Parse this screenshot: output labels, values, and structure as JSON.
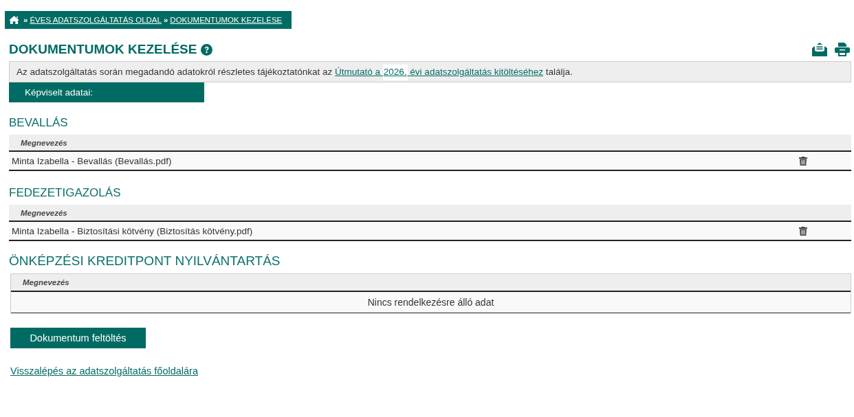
{
  "breadcrumb": [
    {
      "separator": "»",
      "label": "ÉVES ADATSZOLGÁLTATÁS OLDAL"
    },
    {
      "separator": "»",
      "label": "DOKUMENTUMOK KEZELÉSE"
    }
  ],
  "page_title": "DOKUMENTUMOK KEZELÉSE",
  "info": {
    "text": "Az adatszolgáltatás során megadandó adatokról részletes tájékoztatónkat az",
    "link_before": "Útmutató a ",
    "link_year": "2026.",
    "link_after": " évi adatszolgáltatás kitöltéséhez",
    "text_after": "találja."
  },
  "represented_header": "Képviselt adatai:",
  "sections": [
    {
      "kind": "documents",
      "title": "BEVALLÁS",
      "columns": [
        "Megnevezés"
      ],
      "rows": [
        {
          "name": "Minta Izabella - Bevallás (Bevallás.pdf)"
        }
      ]
    },
    {
      "kind": "documents",
      "title": "FEDEZETIGAZOLÁS",
      "columns": [
        "Megnevezés"
      ],
      "rows": [
        {
          "name": "Minta Izabella - Biztosítási kötvény (Biztosítás kötvény.pdf)"
        }
      ]
    },
    {
      "kind": "credits",
      "title": "ÖNKÉPZÉSI KREDITPONT NYILVÁNTARTÁS",
      "columns": [
        "Megnevezés"
      ],
      "empty_message": "Nincs rendelkezésre álló adat"
    }
  ],
  "upload_button": "Dokumentum feltöltés",
  "back_link": "Visszalépés az adatszolgáltatás főoldalára"
}
